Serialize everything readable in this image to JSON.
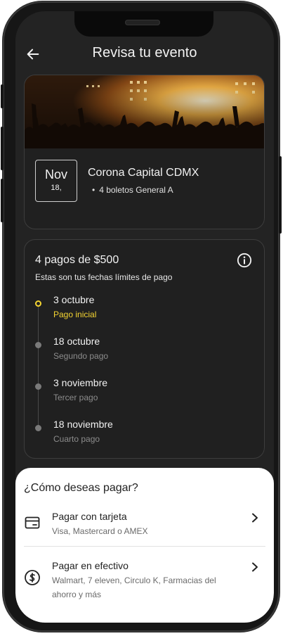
{
  "header": {
    "title": "Revisa tu evento",
    "back_icon": "arrow-left-icon"
  },
  "event": {
    "date_month": "Nov",
    "date_day": "18,",
    "name": "Corona Capital CDMX",
    "tickets": "4 boletos General A",
    "image": "concert-crowd-image"
  },
  "plan": {
    "title": "4 pagos de $500",
    "subtitle": "Estas son tus fechas límites de pago",
    "info_icon": "info-icon",
    "steps": [
      {
        "date": "3 octubre",
        "label": "Pago inicial"
      },
      {
        "date": "18 octubre",
        "label": "Segundo pago"
      },
      {
        "date": "3 noviembre",
        "label": "Tercer pago"
      },
      {
        "date": "18 noviembre",
        "label": "Cuarto pago"
      }
    ]
  },
  "payment": {
    "title": "¿Cómo deseas pagar?",
    "options": [
      {
        "title": "Pagar con tarjeta",
        "subtitle": "Visa, Mastercard o AMEX",
        "icon": "credit-card-icon"
      },
      {
        "title": "Pagar en efectivo",
        "subtitle": "Walmart, 7 eleven, Circulo K, Farmacias del ahorro y más",
        "icon": "cash-icon"
      }
    ]
  },
  "colors": {
    "accent": "#f5d532",
    "background": "#232323",
    "sheet": "#ffffff"
  }
}
